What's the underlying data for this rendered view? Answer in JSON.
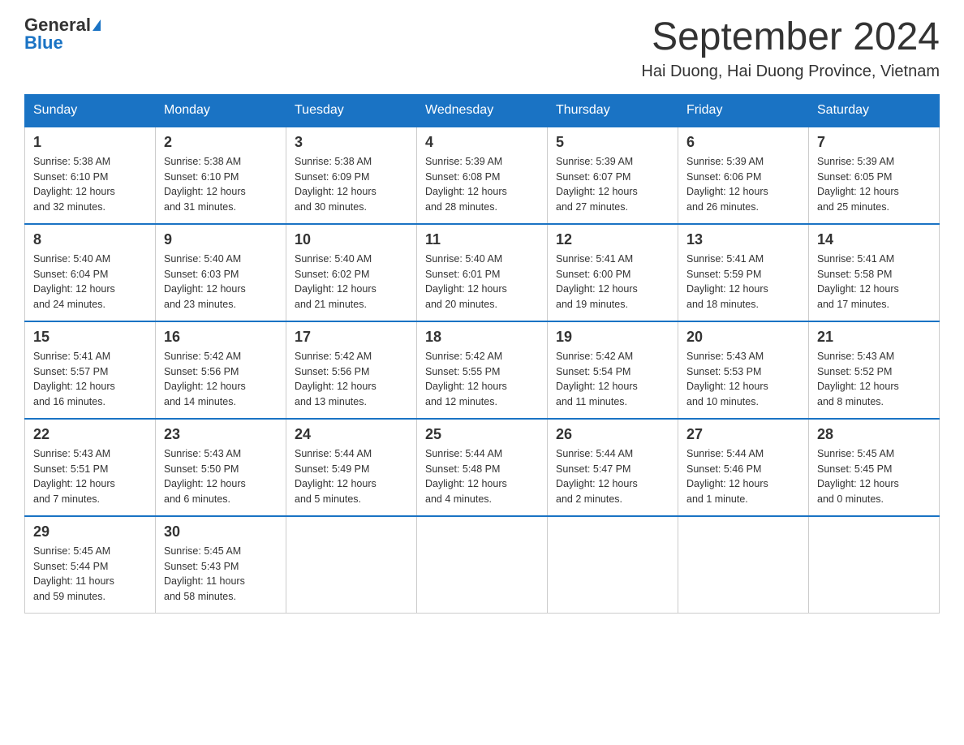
{
  "header": {
    "logo_general": "General",
    "logo_blue": "Blue",
    "month_title": "September 2024",
    "location": "Hai Duong, Hai Duong Province, Vietnam"
  },
  "weekdays": [
    "Sunday",
    "Monday",
    "Tuesday",
    "Wednesday",
    "Thursday",
    "Friday",
    "Saturday"
  ],
  "weeks": [
    [
      {
        "day": "1",
        "sunrise": "5:38 AM",
        "sunset": "6:10 PM",
        "daylight": "12 hours and 32 minutes."
      },
      {
        "day": "2",
        "sunrise": "5:38 AM",
        "sunset": "6:10 PM",
        "daylight": "12 hours and 31 minutes."
      },
      {
        "day": "3",
        "sunrise": "5:38 AM",
        "sunset": "6:09 PM",
        "daylight": "12 hours and 30 minutes."
      },
      {
        "day": "4",
        "sunrise": "5:39 AM",
        "sunset": "6:08 PM",
        "daylight": "12 hours and 28 minutes."
      },
      {
        "day": "5",
        "sunrise": "5:39 AM",
        "sunset": "6:07 PM",
        "daylight": "12 hours and 27 minutes."
      },
      {
        "day": "6",
        "sunrise": "5:39 AM",
        "sunset": "6:06 PM",
        "daylight": "12 hours and 26 minutes."
      },
      {
        "day": "7",
        "sunrise": "5:39 AM",
        "sunset": "6:05 PM",
        "daylight": "12 hours and 25 minutes."
      }
    ],
    [
      {
        "day": "8",
        "sunrise": "5:40 AM",
        "sunset": "6:04 PM",
        "daylight": "12 hours and 24 minutes."
      },
      {
        "day": "9",
        "sunrise": "5:40 AM",
        "sunset": "6:03 PM",
        "daylight": "12 hours and 23 minutes."
      },
      {
        "day": "10",
        "sunrise": "5:40 AM",
        "sunset": "6:02 PM",
        "daylight": "12 hours and 21 minutes."
      },
      {
        "day": "11",
        "sunrise": "5:40 AM",
        "sunset": "6:01 PM",
        "daylight": "12 hours and 20 minutes."
      },
      {
        "day": "12",
        "sunrise": "5:41 AM",
        "sunset": "6:00 PM",
        "daylight": "12 hours and 19 minutes."
      },
      {
        "day": "13",
        "sunrise": "5:41 AM",
        "sunset": "5:59 PM",
        "daylight": "12 hours and 18 minutes."
      },
      {
        "day": "14",
        "sunrise": "5:41 AM",
        "sunset": "5:58 PM",
        "daylight": "12 hours and 17 minutes."
      }
    ],
    [
      {
        "day": "15",
        "sunrise": "5:41 AM",
        "sunset": "5:57 PM",
        "daylight": "12 hours and 16 minutes."
      },
      {
        "day": "16",
        "sunrise": "5:42 AM",
        "sunset": "5:56 PM",
        "daylight": "12 hours and 14 minutes."
      },
      {
        "day": "17",
        "sunrise": "5:42 AM",
        "sunset": "5:56 PM",
        "daylight": "12 hours and 13 minutes."
      },
      {
        "day": "18",
        "sunrise": "5:42 AM",
        "sunset": "5:55 PM",
        "daylight": "12 hours and 12 minutes."
      },
      {
        "day": "19",
        "sunrise": "5:42 AM",
        "sunset": "5:54 PM",
        "daylight": "12 hours and 11 minutes."
      },
      {
        "day": "20",
        "sunrise": "5:43 AM",
        "sunset": "5:53 PM",
        "daylight": "12 hours and 10 minutes."
      },
      {
        "day": "21",
        "sunrise": "5:43 AM",
        "sunset": "5:52 PM",
        "daylight": "12 hours and 8 minutes."
      }
    ],
    [
      {
        "day": "22",
        "sunrise": "5:43 AM",
        "sunset": "5:51 PM",
        "daylight": "12 hours and 7 minutes."
      },
      {
        "day": "23",
        "sunrise": "5:43 AM",
        "sunset": "5:50 PM",
        "daylight": "12 hours and 6 minutes."
      },
      {
        "day": "24",
        "sunrise": "5:44 AM",
        "sunset": "5:49 PM",
        "daylight": "12 hours and 5 minutes."
      },
      {
        "day": "25",
        "sunrise": "5:44 AM",
        "sunset": "5:48 PM",
        "daylight": "12 hours and 4 minutes."
      },
      {
        "day": "26",
        "sunrise": "5:44 AM",
        "sunset": "5:47 PM",
        "daylight": "12 hours and 2 minutes."
      },
      {
        "day": "27",
        "sunrise": "5:44 AM",
        "sunset": "5:46 PM",
        "daylight": "12 hours and 1 minute."
      },
      {
        "day": "28",
        "sunrise": "5:45 AM",
        "sunset": "5:45 PM",
        "daylight": "12 hours and 0 minutes."
      }
    ],
    [
      {
        "day": "29",
        "sunrise": "5:45 AM",
        "sunset": "5:44 PM",
        "daylight": "11 hours and 59 minutes."
      },
      {
        "day": "30",
        "sunrise": "5:45 AM",
        "sunset": "5:43 PM",
        "daylight": "11 hours and 58 minutes."
      },
      null,
      null,
      null,
      null,
      null
    ]
  ],
  "labels": {
    "sunrise": "Sunrise:",
    "sunset": "Sunset:",
    "daylight": "Daylight:"
  }
}
